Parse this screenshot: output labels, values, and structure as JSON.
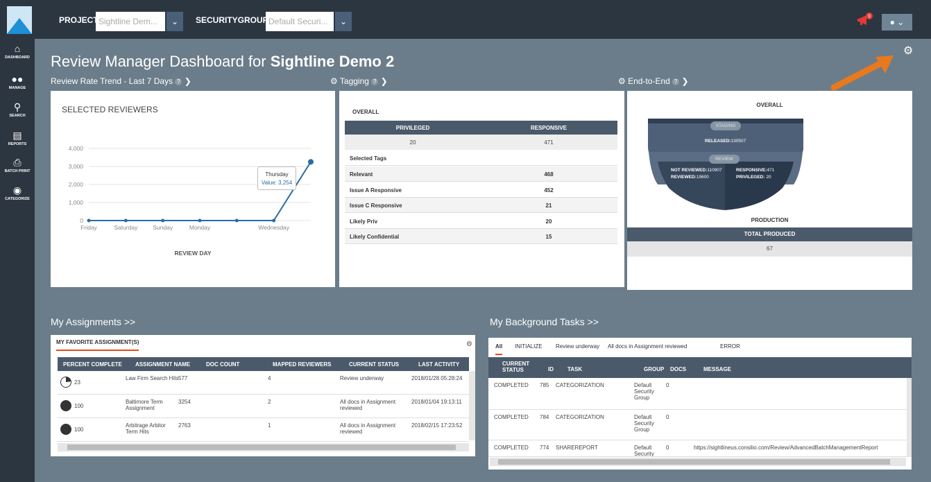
{
  "topbar": {
    "project_label": "PROJECT:",
    "project_value": "Sightline Dem...",
    "securitygroup_label": "SECURITYGROUP:",
    "securitygroup_value": "Default Securi...",
    "notification_count": "9",
    "bell_icon": "megaphone-icon",
    "user_icon": "user-icon"
  },
  "sidebar": {
    "items": [
      {
        "label": "DASHBOARD",
        "icon": "home-icon"
      },
      {
        "label": "MANAGE",
        "icon": "users-icon"
      },
      {
        "label": "SEARCH",
        "icon": "search-icon"
      },
      {
        "label": "REPORTS",
        "icon": "bar-chart-icon"
      },
      {
        "label": "BATCH PRINT",
        "icon": "print-icon"
      },
      {
        "label": "CATEGORIZE",
        "icon": "eye-icon"
      }
    ]
  },
  "page": {
    "title_prefix": "Review Manager Dashboard for ",
    "title_project": "Sightline Demo 2"
  },
  "sections": {
    "review_rate": "Review Rate Trend - Last 7 Days",
    "tagging": "Tagging",
    "end_to_end": "End-to-End"
  },
  "chart_data": {
    "type": "line",
    "title": "SELECTED REVIEWERS",
    "xlabel": "REVIEW DAY",
    "ylabel": "",
    "categories": [
      "Friday",
      "Saturday",
      "Sunday",
      "Monday",
      "",
      "Wednesday",
      "Thursday"
    ],
    "x_tick_labels": [
      "Friday",
      "Saturday",
      "Sunday",
      "Monday",
      "Wednesday"
    ],
    "y_ticks": [
      "0",
      "1,000",
      "2,000",
      "3,000",
      "4,000"
    ],
    "ylim": [
      0,
      4000
    ],
    "values": [
      0,
      0,
      0,
      0,
      0,
      0,
      3254
    ],
    "tooltip": {
      "day": "Thursday",
      "value": "Value: 3,254"
    },
    "colors": {
      "line": "#2a6ba0"
    }
  },
  "tagging": {
    "overall": "OVERALL",
    "col1": "PRIVILEGED",
    "col2": "RESPONSIVE",
    "val1": "20",
    "val2": "471",
    "selected_tags": "Selected Tags",
    "rows": [
      {
        "name": "Relevant",
        "value": "468"
      },
      {
        "name": "Issue A Responsive",
        "value": "452"
      },
      {
        "name": "Issue C Responsive",
        "value": "21"
      },
      {
        "name": "Likely Priv",
        "value": "20"
      },
      {
        "name": "Likely Confidential",
        "value": "15"
      }
    ]
  },
  "e2e": {
    "overall": "OVERALL",
    "staging": "STAGING",
    "released_label": "RELEASED:",
    "released_value": "130507",
    "review": "REVIEW",
    "not_reviewed_label": "NOT REVIEWED:",
    "not_reviewed_value": "110907",
    "reviewed_label": "REVIEWED:",
    "reviewed_value": "19600",
    "responsive_label": "RESPONSIVE:",
    "responsive_value": "471",
    "privileged_label": "PRIVILEGED:",
    "privileged_value": "20",
    "production": "PRODUCTION",
    "total_produced_label": "TOTAL PRODUCED",
    "total_produced_value": "67"
  },
  "assignments": {
    "title": "My Assignments >>",
    "tab": "MY FAVORITE ASSIGNMENT(S)",
    "columns": [
      "PERCENT COMPLETE",
      "ASSIGNMENT NAME",
      "DOC COUNT",
      "MAPPED REVIEWERS",
      "CURRENT STATUS",
      "LAST ACTIVITY"
    ],
    "rows": [
      {
        "percent": "23",
        "name": "Law Firm Search Hits",
        "docs": "577",
        "reviewers": "4",
        "status": "Review underway",
        "activity": "2018/01/28 05:28:24"
      },
      {
        "percent": "100",
        "name": "Baltimore Term Assignment",
        "docs": "3254",
        "reviewers": "2",
        "status": "All docs in Assignment reviewed",
        "activity": "2018/01/04 19:13:11"
      },
      {
        "percent": "100",
        "name": "Arbitrage Arbitor Term Hits",
        "docs": "2763",
        "reviewers": "1",
        "status": "All docs in Assignment reviewed",
        "activity": "2018/02/15 17:23:52"
      }
    ]
  },
  "background": {
    "title": "My Background Tasks >>",
    "tabs": [
      "All",
      "INITIALIZE",
      "Review underway",
      "All docs in Assignment reviewed",
      "ERROR"
    ],
    "columns": [
      "CURRENT STATUS",
      "ID",
      "TASK",
      "GROUP",
      "DOCS",
      "MESSAGE"
    ],
    "rows": [
      {
        "status": "COMPLETED",
        "id": "785",
        "task": "CATEGORIZATION",
        "group": "Default Security Group",
        "docs": "0",
        "message": ""
      },
      {
        "status": "COMPLETED",
        "id": "784",
        "task": "CATEGORIZATION",
        "group": "Default Security Group",
        "docs": "0",
        "message": ""
      },
      {
        "status": "COMPLETED",
        "id": "774",
        "task": "SHAREREPORT",
        "group": "Default Security",
        "docs": "0",
        "message": "https://sightlineus.consilio.com/Review/AdvancedBatchManagementReport"
      }
    ]
  }
}
